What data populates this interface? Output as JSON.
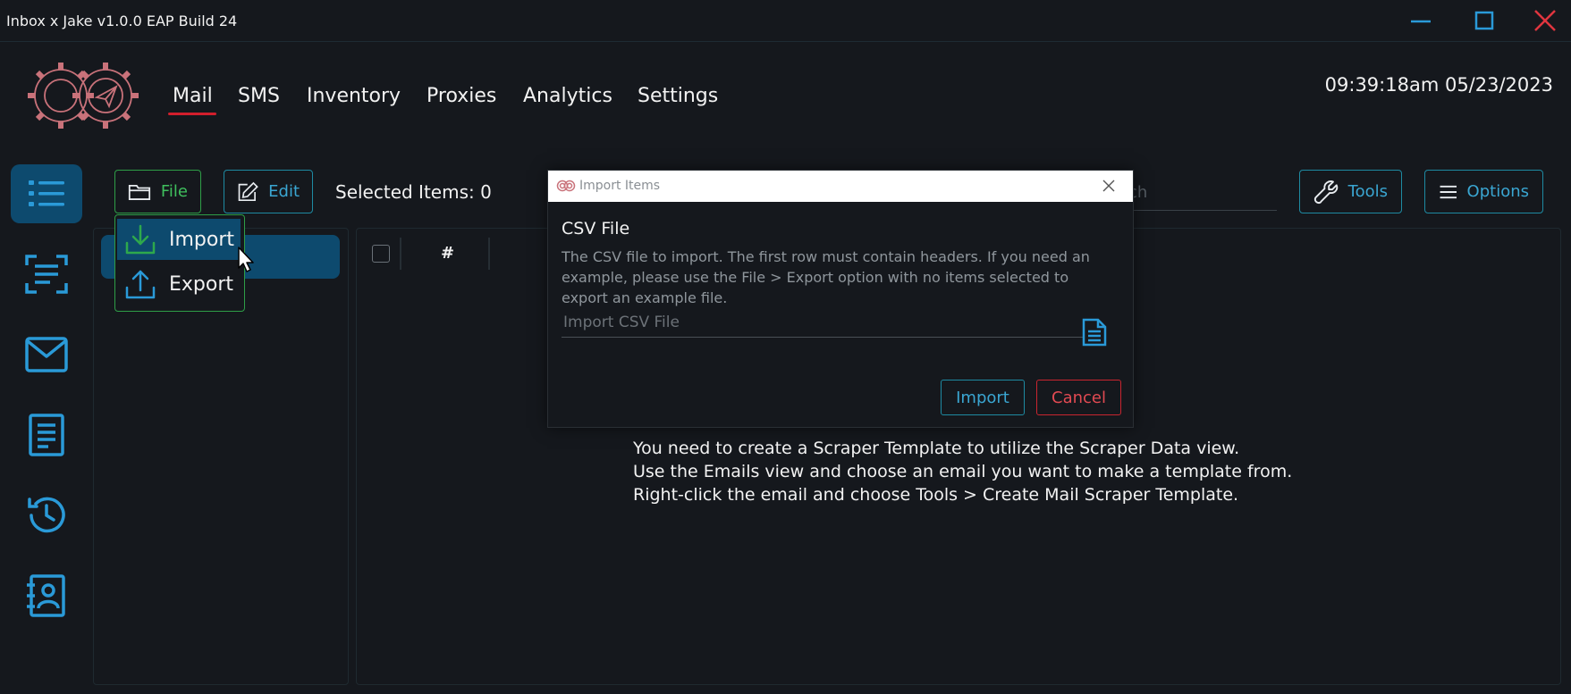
{
  "window": {
    "title": "Inbox x Jake v1.0.0 EAP Build 24",
    "controls": [
      "minimize-icon",
      "maximize-icon",
      "close-icon"
    ]
  },
  "nav": {
    "items": [
      "Mail",
      "SMS",
      "Inventory",
      "Proxies",
      "Analytics",
      "Settings"
    ],
    "active": "Mail"
  },
  "clock": "09:39:18am 05/23/2023",
  "sidebar": {
    "items": [
      {
        "icon": "list-icon",
        "active": true
      },
      {
        "icon": "scan-icon",
        "active": false
      },
      {
        "icon": "mail-icon",
        "active": false
      },
      {
        "icon": "document-icon",
        "active": false
      },
      {
        "icon": "history-icon",
        "active": false
      },
      {
        "icon": "contacts-icon",
        "active": false
      }
    ]
  },
  "toolbar": {
    "file_label": "File",
    "edit_label": "Edit",
    "selected_items": "Selected Items: 0",
    "search_fragment": "ch",
    "tools_label": "Tools",
    "options_label": "Options"
  },
  "file_menu": {
    "import_label": "Import",
    "export_label": "Export"
  },
  "table": {
    "header_hash": "#"
  },
  "empty_message": [
    "You need to create a Scraper Template to utilize the Scraper Data view.",
    "Use the Emails view and choose an email you want to make a template from.",
    "Right-click the email and choose Tools > Create Mail Scraper Template."
  ],
  "dialog": {
    "title": "Import Items",
    "heading": "CSV File",
    "description": "The CSV file to import. The first row must contain headers. If you need an example, please use the File > Export option with no items selected to export an example file.",
    "input_placeholder": "Import CSV File",
    "input_value": "",
    "import_label": "Import",
    "cancel_label": "Cancel"
  },
  "colors": {
    "background": "#15181d",
    "accent_blue": "#3aa6d2",
    "accent_green": "#3fbf5d",
    "accent_red": "#d21f2c",
    "active_fill": "#0d4a6e",
    "logo": "#c9727a"
  }
}
